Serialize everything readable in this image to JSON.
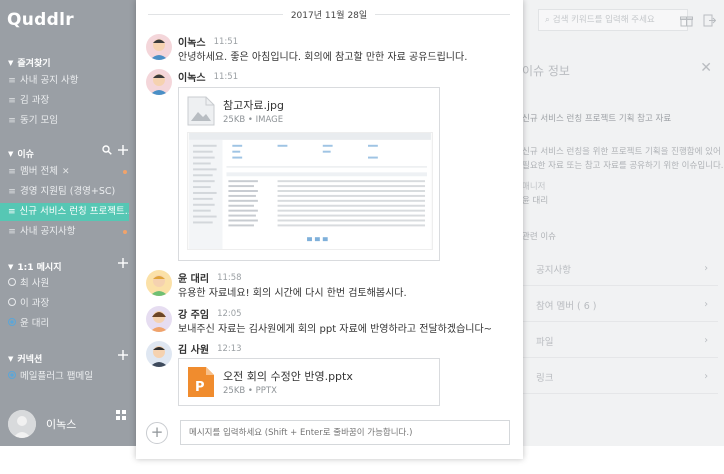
{
  "app": {
    "logo_text": "Quddlr"
  },
  "sidebar": {
    "favorites": {
      "title": "즐겨찾기",
      "items": [
        {
          "label": "사내 공지 사항"
        },
        {
          "label": "김 과장"
        },
        {
          "label": "동기 모임"
        }
      ]
    },
    "issues": {
      "title": "이슈",
      "items": [
        {
          "label": "멤버 전체",
          "muted": true,
          "has_dot": true
        },
        {
          "label": "경영 지원팀 (경영+SC)"
        },
        {
          "label": "신규 서비스 런칭 프로젝트...",
          "active": true
        },
        {
          "label": "사내 공지사항",
          "has_dot": true
        }
      ]
    },
    "dm": {
      "title": "1:1 메시지",
      "items": [
        {
          "label": "최 사원"
        },
        {
          "label": "이 과장"
        },
        {
          "label": "윤 대리",
          "selected": true
        }
      ]
    },
    "connect": {
      "title": "커넥션",
      "items": [
        {
          "label": "메일플러그 팹메일",
          "selected": true
        }
      ]
    },
    "me": {
      "name": "이녹스"
    }
  },
  "chat": {
    "date": "2017년 11월 28일",
    "messages": [
      {
        "name": "이녹스",
        "time": "11:51",
        "text": "안녕하세요. 좋은 아침입니다. 회의에 참고할 만한 자료 공유드립니다."
      },
      {
        "name": "이녹스",
        "time": "11:51",
        "attachment": {
          "filename": "참고자료.jpg",
          "meta": "25KB • IMAGE"
        }
      },
      {
        "name": "윤 대리",
        "time": "11:58",
        "text": "유용한 자료네요! 회의 시간에 다시 한번 검토해봅시다."
      },
      {
        "name": "강 주임",
        "time": "12:05",
        "text": "보내주신 자료는 김사원에게 회의 ppt 자료에 반영하라고 전달하겠습니다~"
      },
      {
        "name": "김 사원",
        "time": "12:13",
        "attachment": {
          "filename": "오전 회의 수정안 반영.pptx",
          "meta": "25KB • PPTX"
        }
      }
    ],
    "input_placeholder": "메시지를 입력하세요 (Shift + Enter로 줄바꿈이 가능합니다.)"
  },
  "right_panel": {
    "search_placeholder": "검색 키워드를 입력해 주세요",
    "title": "이슈 정보",
    "desc_title": "신규 서비스 런칭 프로젝트 기획 참고 자료",
    "desc_line1": "신규 서비스 런칭을 위한 프로젝트 기획을 진행함에 있어",
    "desc_line2": "필요한 자료 또는 참고 자료를 공유하기 위한 이슈입니다.",
    "manager_label": "매니저",
    "manager_name": "윤 대리",
    "related_label": "관련 이슈",
    "rows": [
      {
        "label": "공지사항"
      },
      {
        "label": "참여 멤버 ( 6 )"
      },
      {
        "label": "파일"
      },
      {
        "label": "링크"
      }
    ]
  },
  "colors": {
    "accent": "#56c7b4",
    "ppt": "#f08c2e",
    "sidebar_dim": "#9a9fa5"
  }
}
